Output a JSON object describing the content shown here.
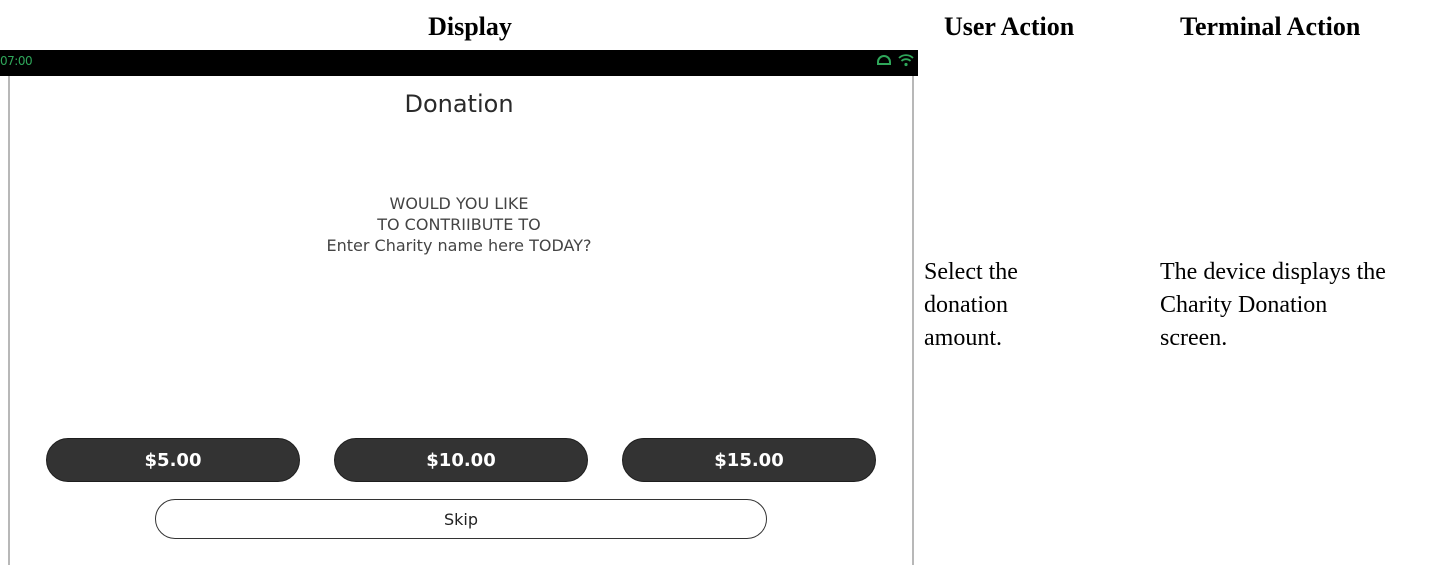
{
  "headers": {
    "display": "Display",
    "user_action": "User Action",
    "terminal_action": "Terminal Action"
  },
  "device": {
    "status_bar": {
      "time": "07:00",
      "icons": [
        "cloud-icon",
        "wifi-icon"
      ],
      "time_color": "#2fa75a"
    },
    "title": "Donation",
    "prompt_lines": [
      "WOULD YOU LIKE",
      "TO CONTRIIBUTE TO",
      "Enter Charity name here TODAY?"
    ],
    "amount_buttons": [
      "$5.00",
      "$10.00",
      "$15.00"
    ],
    "skip_label": "Skip",
    "button_color": "#333333"
  },
  "user_action_lines": [
    "Select the",
    "donation",
    "amount."
  ],
  "terminal_action_lines": [
    "The device displays the",
    "Charity Donation",
    "screen."
  ]
}
